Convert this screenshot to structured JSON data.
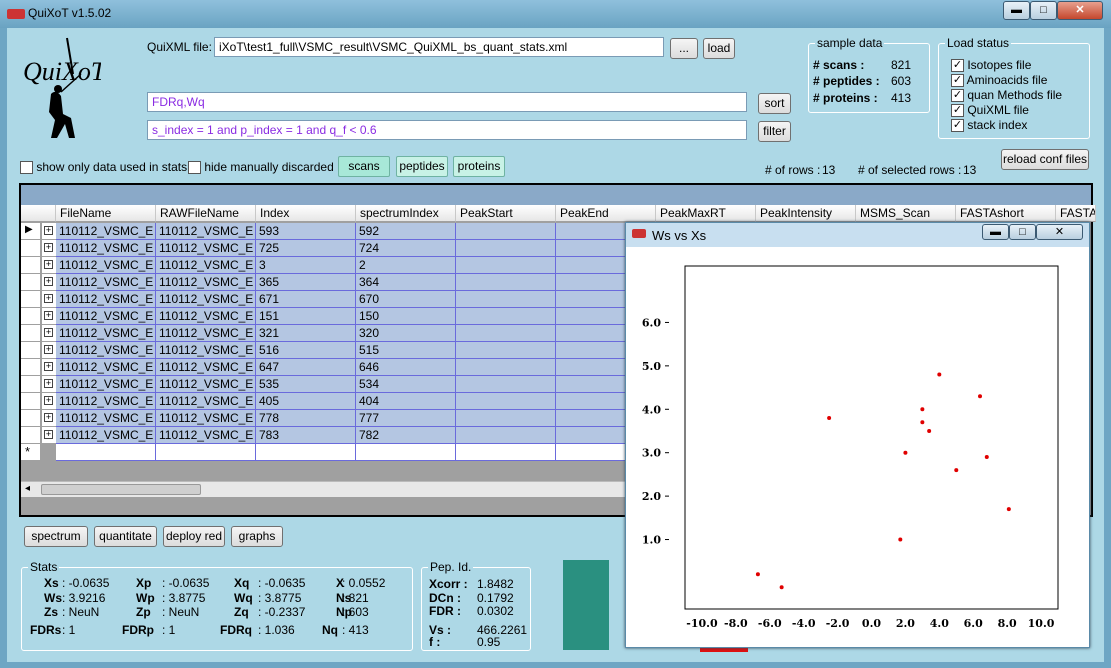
{
  "app": {
    "title": "QuiXoT v1.5.02"
  },
  "window_buttons": {
    "minimize": "▬",
    "maximize": "□",
    "close": "✕"
  },
  "file": {
    "label": "QuiXML file:",
    "value": "iXoT\\test1_full\\VSMC_result\\VSMC_QuiXML_bs_quant_stats.xml",
    "browse": "...",
    "load": "load"
  },
  "sort": {
    "value": "FDRq,Wq",
    "button": "sort"
  },
  "filter": {
    "value": "s_index = 1 and p_index = 1 and q_f < 0.6",
    "button": "filter"
  },
  "sample": {
    "title": "sample data",
    "scans_label": "# scans :",
    "scans": "821",
    "peptides_label": "# peptides :",
    "peptides": "603",
    "proteins_label": "# proteins :",
    "proteins": "413"
  },
  "load_status": {
    "title": "Load status",
    "items": [
      "Isotopes file",
      "Aminoacids file",
      "quan Methods file",
      "QuiXML file",
      "stack index"
    ]
  },
  "options": {
    "show_only": "show only data used in stats",
    "hide_manual": "hide manually discarded"
  },
  "tabs": [
    "scans",
    "peptides",
    "proteins"
  ],
  "counts": {
    "rows_label": "# of rows :",
    "rows": "13",
    "selected_label": "# of  selected rows :",
    "selected": "13"
  },
  "reload": "reload conf files",
  "grid": {
    "columns": [
      "FileName",
      "RAWFileName",
      "Index",
      "spectrumIndex",
      "PeakStart",
      "PeakEnd",
      "PeakMaxRT",
      "PeakIntensity",
      "MSMS_Scan",
      "FASTAshort",
      "FASTA"
    ],
    "rows": [
      [
        "110112_VSMC_E",
        "110112_VSMC_E",
        "593",
        "592"
      ],
      [
        "110112_VSMC_E",
        "110112_VSMC_E",
        "725",
        "724"
      ],
      [
        "110112_VSMC_E",
        "110112_VSMC_E",
        "3",
        "2"
      ],
      [
        "110112_VSMC_E",
        "110112_VSMC_E",
        "365",
        "364"
      ],
      [
        "110112_VSMC_E",
        "110112_VSMC_E",
        "671",
        "670"
      ],
      [
        "110112_VSMC_E",
        "110112_VSMC_E",
        "151",
        "150"
      ],
      [
        "110112_VSMC_E",
        "110112_VSMC_E",
        "321",
        "320"
      ],
      [
        "110112_VSMC_E",
        "110112_VSMC_E",
        "516",
        "515"
      ],
      [
        "110112_VSMC_E",
        "110112_VSMC_E",
        "647",
        "646"
      ],
      [
        "110112_VSMC_E",
        "110112_VSMC_E",
        "535",
        "534"
      ],
      [
        "110112_VSMC_E",
        "110112_VSMC_E",
        "405",
        "404"
      ],
      [
        "110112_VSMC_E",
        "110112_VSMC_E",
        "778",
        "777"
      ],
      [
        "110112_VSMC_E",
        "110112_VSMC_E",
        "783",
        "782"
      ]
    ]
  },
  "actions": [
    "spectrum",
    "quantitate",
    "deploy red",
    "graphs"
  ],
  "stats": {
    "title": "Stats",
    "xs_l": "Xs",
    "xs": ": -0.0635",
    "xp_l": "Xp",
    "xp": ": -0.0635",
    "xq_l": "Xq",
    "xq": ": -0.0635",
    "x_l": "X",
    "x": ": 0.0552",
    "ws_l": "Ws",
    "ws": ": 3.9216",
    "wp_l": "Wp",
    "wp": ": 3.8775",
    "wq_l": "Wq",
    "wq": ": 3.8775",
    "ns_l": "Ns",
    "ns": ": 821",
    "zs_l": "Zs",
    "zs": ": NeuN",
    "zp_l": "Zp",
    "zp": ": NeuN",
    "zq_l": "Zq",
    "zq": ": -0.2337",
    "np_l": "Np",
    "np": ": 603",
    "fdrs_l": "FDRs",
    "fdrs": ": 1",
    "fdrp_l": "FDRp",
    "fdrp": ": 1",
    "fdrq_l": "FDRq",
    "fdrq": ": 1.036",
    "nq_l": "Nq",
    "nq": ": 413"
  },
  "pep": {
    "title": "Pep. Id.",
    "xcorr_l": "Xcorr :",
    "xcorr": "1.8482",
    "dcn_l": "DCn :",
    "dcn": "0.1792",
    "fdr_l": "FDR :",
    "fdr": "0.0302",
    "vs_l": "Vs :",
    "vs": "466.2261",
    "f_l": "f :",
    "f": "0.95"
  },
  "plot_window": {
    "title": "Ws vs Xs"
  },
  "chart_data": {
    "type": "scatter",
    "title": "",
    "xlabel": "",
    "ylabel": "",
    "xlim": [
      -11,
      11
    ],
    "ylim": [
      -0.6,
      7.3
    ],
    "xticks": [
      "-10.0",
      "-8.0",
      "-6.0",
      "-4.0",
      "-2.0",
      "0.0",
      "2.0",
      "4.0",
      "6.0",
      "8.0",
      "10.0"
    ],
    "yticks": [
      "1.0",
      "2.0",
      "3.0",
      "4.0",
      "5.0",
      "6.0"
    ],
    "color": "#e00000",
    "points": [
      [
        -6.7,
        0.2
      ],
      [
        -5.3,
        -0.1
      ],
      [
        -2.5,
        3.8
      ],
      [
        1.7,
        1.0
      ],
      [
        2.0,
        3.0
      ],
      [
        3.0,
        4.0
      ],
      [
        3.0,
        3.7
      ],
      [
        3.4,
        3.5
      ],
      [
        4.0,
        4.8
      ],
      [
        5.0,
        2.6
      ],
      [
        6.4,
        4.3
      ],
      [
        6.8,
        2.9
      ],
      [
        8.1,
        1.7
      ]
    ]
  }
}
